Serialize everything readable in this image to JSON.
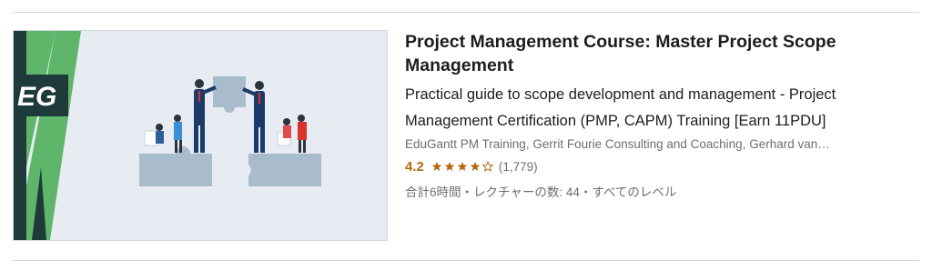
{
  "course": {
    "title": "Project Management Course: Master Project Scope Management",
    "headline": "Practical guide to scope development and management - Project Management Certification (PMP, CAPM) Training [Earn 11PDU]",
    "instructors": "EduGantt PM Training, Gerrit Fourie Consulting and Coaching, Gerhard van…",
    "rating": "4.2",
    "rating_value": 4.2,
    "rating_max": 5,
    "rating_count": "(1,779)",
    "meta": "合計6時間・レクチャーの数: 44・すべてのレベル",
    "thumbnail": {
      "logo_text": "EG",
      "image_icon": "puzzle-teamwork-illustration"
    }
  },
  "colors": {
    "rating": "#b4690e",
    "text_primary": "#1c1d1f",
    "text_secondary": "#6a6f73",
    "thumb_bg": "#e7ebf2",
    "thumb_green": "#5fb56a",
    "thumb_dark": "#1f3a3b"
  }
}
